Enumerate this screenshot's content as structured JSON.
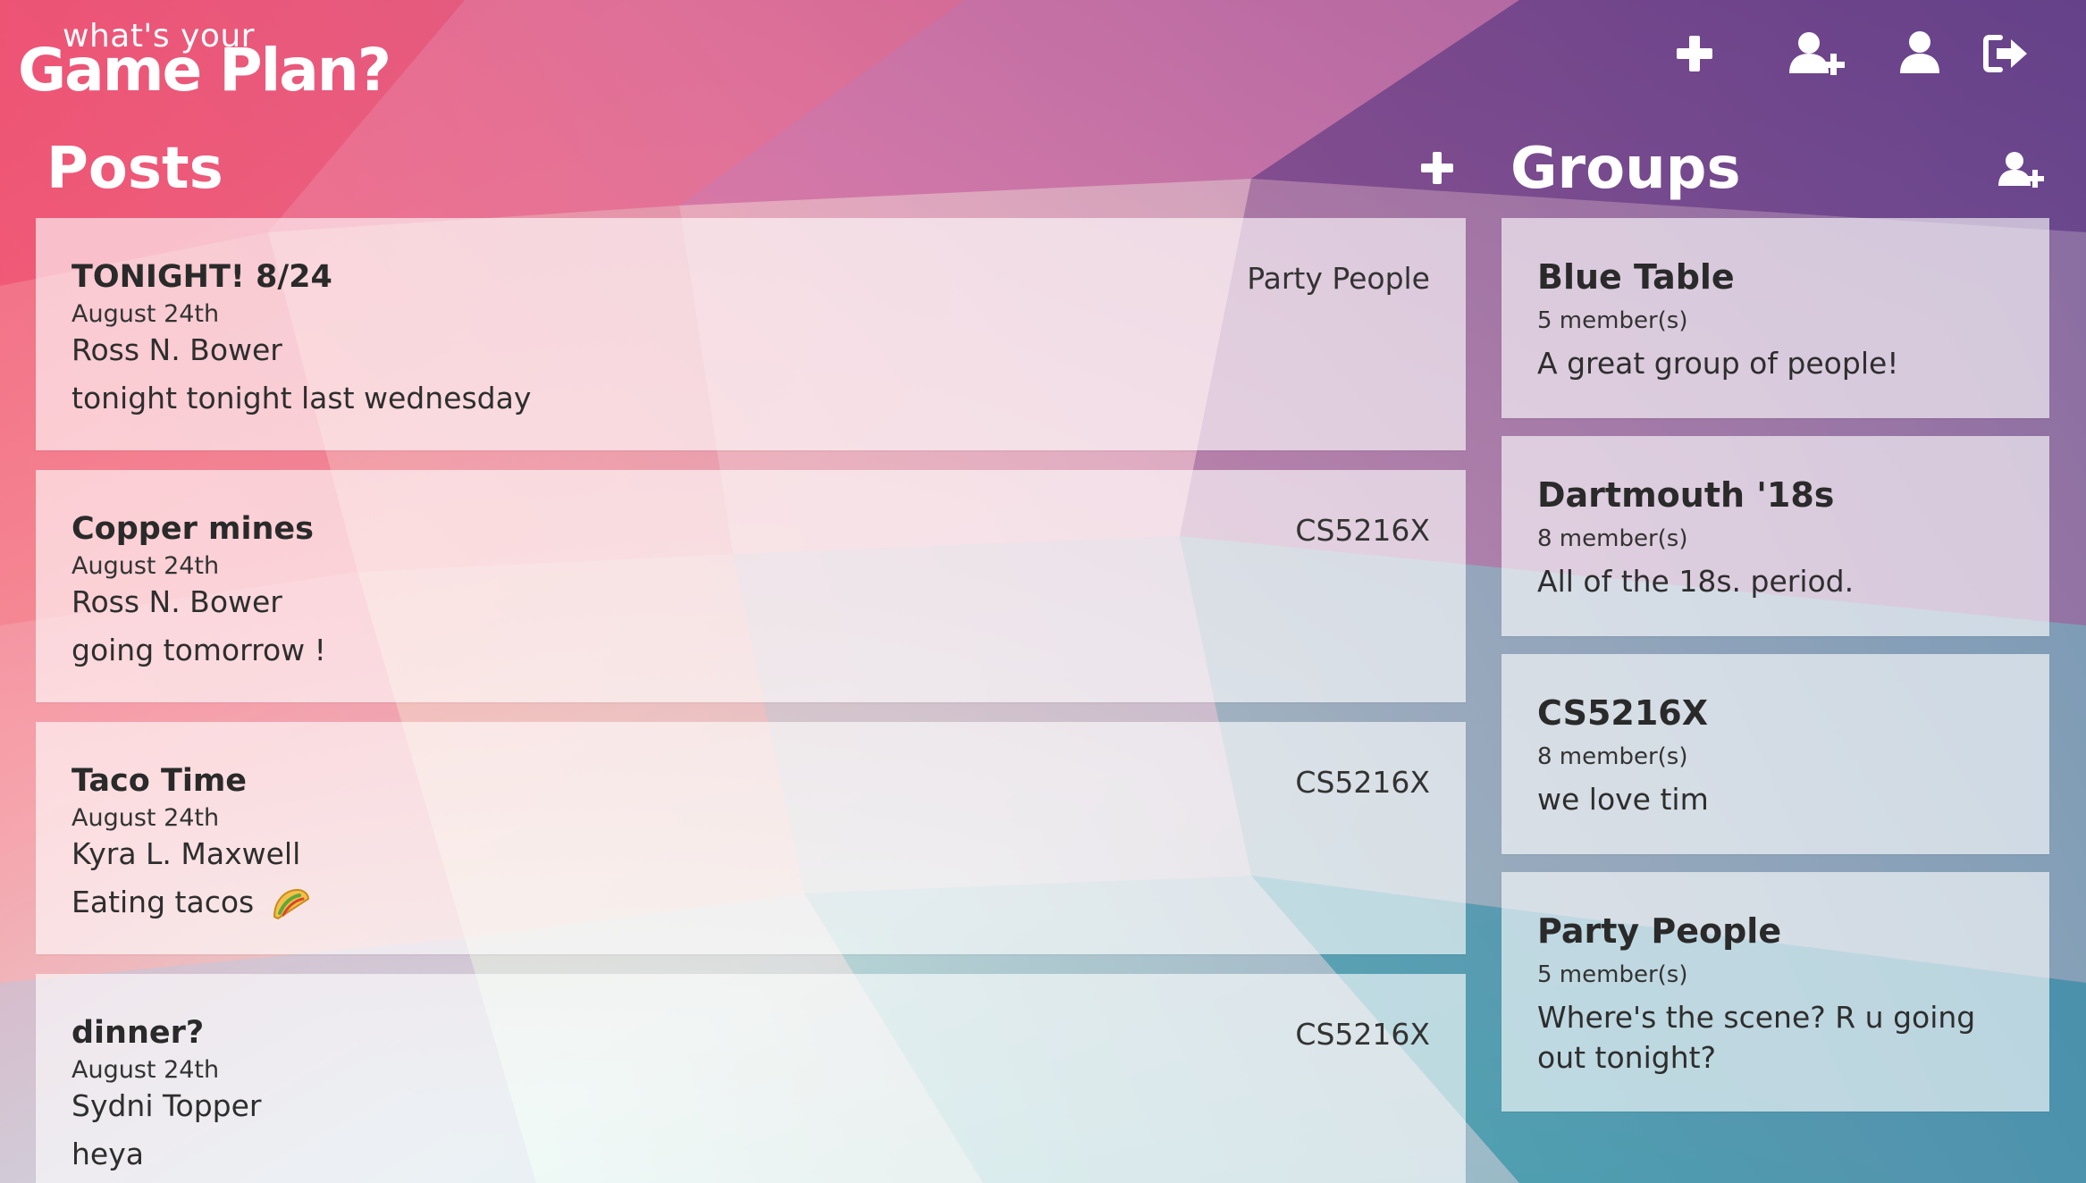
{
  "header": {
    "logo_small": "what's your",
    "logo_big": "Game Plan?",
    "icons": [
      "plus-icon",
      "add-user-icon",
      "user-icon",
      "sign-out-icon"
    ]
  },
  "posts_section": {
    "title": "Posts",
    "posts": [
      {
        "title": "TONIGHT! 8/24",
        "date": "August 24th",
        "author": "Ross N. Bower",
        "body": "tonight tonight last wednesday",
        "group": "Party People"
      },
      {
        "title": "Copper mines",
        "date": "August 24th",
        "author": "Ross N. Bower",
        "body": "going tomorrow !",
        "group": "CS5216X"
      },
      {
        "title": "Taco Time",
        "date": "August 24th",
        "author": "Kyra L. Maxwell",
        "body": "Eating tacos",
        "group": "CS5216X"
      },
      {
        "title": "dinner?",
        "date": "August 24th",
        "author": "Sydni Topper",
        "body": "heya",
        "group": "CS5216X"
      }
    ]
  },
  "groups_section": {
    "title": "Groups",
    "groups": [
      {
        "name": "Blue Table",
        "members": "5 member(s)",
        "description": "A great group of people!"
      },
      {
        "name": "Dartmouth '18s",
        "members": "8 member(s)",
        "description": "All of the 18s. period."
      },
      {
        "name": "CS5216X",
        "members": "8 member(s)",
        "description": "we love tim"
      },
      {
        "name": "Party People",
        "members": "5 member(s)",
        "description": "Where's the scene? R u going out tonight?"
      }
    ]
  },
  "colors": {
    "top_left": "#f2506e",
    "top_right": "#6b3a8a",
    "bottom_right": "#22b3b8",
    "card_bg": "#ffffff"
  }
}
